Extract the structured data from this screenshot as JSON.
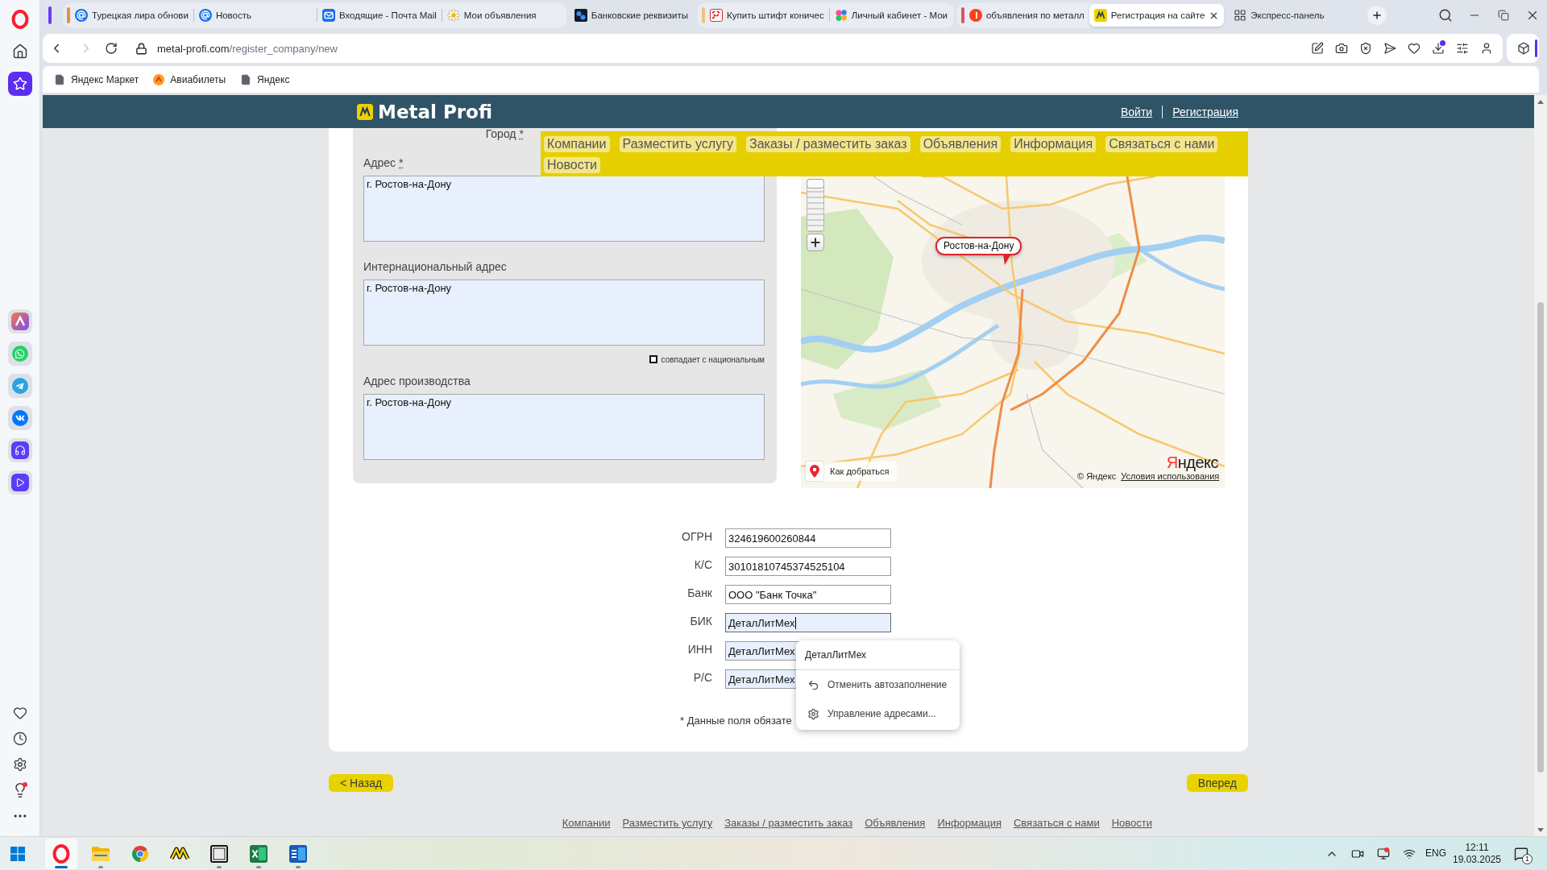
{
  "browser": {
    "tab_groups": [
      {
        "color": "#f08a3c",
        "tabs": [
          {
            "title": "Турецкая лира обнови",
            "selected": false
          },
          {
            "title": "Новость",
            "selected": false
          },
          {
            "title": "Входящие - Почта Mail",
            "selected": false
          },
          {
            "title": "Мои объявления",
            "selected": false
          }
        ]
      },
      {
        "tabs": [
          {
            "title": "Банковские реквизиты",
            "selected": false
          }
        ]
      },
      {
        "color": "#f0c27c",
        "tabs": [
          {
            "title": "Купить штифт коничес",
            "selected": false
          },
          {
            "title": "Личный кабинет - Мои",
            "selected": false
          }
        ]
      },
      {
        "color": "#e5515b",
        "tabs": [
          {
            "title": "объявления по металл",
            "selected": false
          },
          {
            "title": "Регистрация на сайте",
            "selected": true
          }
        ]
      },
      {
        "tabs": [
          {
            "title": "Экспресс-панель",
            "selected": false
          }
        ]
      }
    ],
    "forward_disabled": true,
    "address": {
      "host": "metal-profi.com",
      "path": "/register_company/new"
    },
    "bookmarks": [
      "Яндекс Маркет",
      "Авиабилеты",
      "Яндекс"
    ]
  },
  "site": {
    "logo": "Metal Profi",
    "auth_links": [
      "Войти",
      "Регистрация"
    ],
    "nav": [
      "Компании",
      "Разместить услугу",
      "Заказы / разместить заказ",
      "Объявления",
      "Информация",
      "Связаться с нами",
      "Новости"
    ],
    "address_form": {
      "city": {
        "label": "Город",
        "required_mark": "*"
      },
      "fields": [
        {
          "label": "Адрес",
          "required_mark": "*",
          "value": "г. Ростов-на-Дону",
          "autofilled": true
        },
        {
          "label": "Интернациональный адрес",
          "value": "г. Ростов-на-Дону",
          "autofilled": true,
          "same_as_national": {
            "label": "совпадает с национальным",
            "checked": false
          }
        },
        {
          "label": "Адрес производства",
          "value": "г. Ростов-на-Дону",
          "autofilled": true
        }
      ]
    },
    "map": {
      "zoom_slider": {
        "level": 1
      },
      "balloon": "Ростов-на-Дону",
      "route_button": "Как добраться",
      "logo": "Яндекс",
      "copyright": "© Яндекс",
      "terms_link": "Условия использования"
    },
    "bank_form": [
      {
        "label": "ОГРН",
        "value": "324619600260844",
        "autofilled": false,
        "focused": false
      },
      {
        "label": "К/С",
        "value": "30101810745374525104",
        "autofilled": false,
        "focused": false
      },
      {
        "label": "Банк",
        "value": "ООО \"Банк Точка\"",
        "autofilled": false,
        "focused": false
      },
      {
        "label": "БИК",
        "value": "ДеталЛитМех",
        "autofilled": true,
        "focused": true
      },
      {
        "label": "ИНН",
        "value": "ДеталЛитМех",
        "autofilled": true,
        "focused": false
      },
      {
        "label": "Р/С",
        "value": "ДеталЛитМех",
        "autofilled": true,
        "focused": false
      }
    ],
    "required_note": "* Данные поля обязате",
    "autofill_popup": {
      "suggestion": "ДеталЛитМех",
      "actions": [
        "Отменить автозаполнение",
        "Управление адресами..."
      ]
    },
    "back_button": "< Назад",
    "next_button": "Вперед",
    "footer_links": [
      "Компании",
      "Разместить услугу",
      "Заказы / разместить заказ",
      "Объявления",
      "Информация",
      "Связаться с нами",
      "Новости"
    ]
  },
  "taskbar": {
    "apps": [
      {
        "selected": true,
        "running": true
      },
      {
        "selected": false,
        "running": true
      },
      {
        "selected": false,
        "running": false
      },
      {
        "selected": false,
        "running": false
      },
      {
        "selected": false,
        "running": true
      },
      {
        "selected": false,
        "running": true
      },
      {
        "selected": false,
        "running": true
      }
    ],
    "language": "ENG",
    "time": "12:11",
    "date": "19.03.2025",
    "notification_count": "1"
  }
}
